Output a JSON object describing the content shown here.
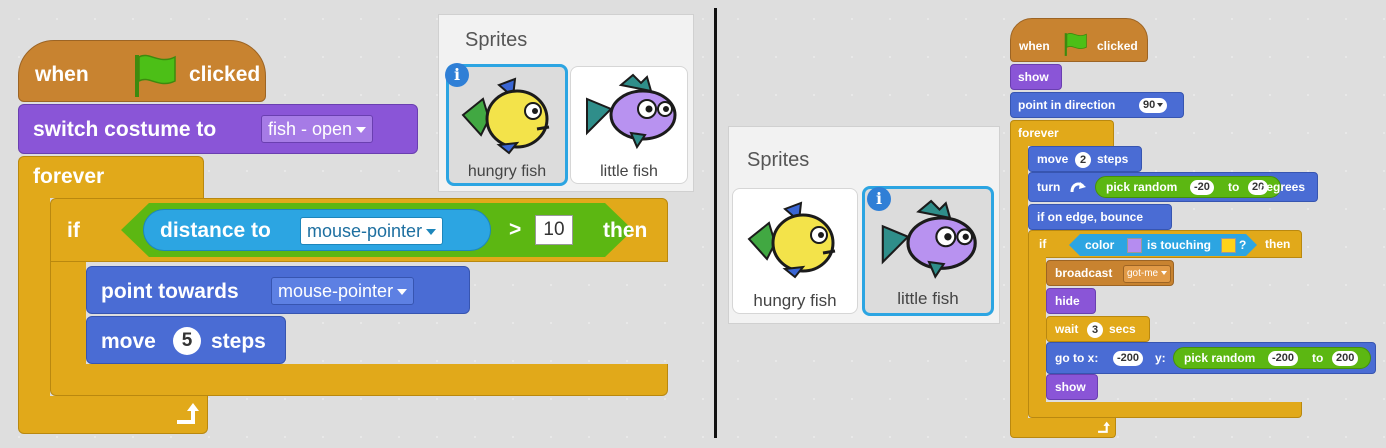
{
  "left": {
    "hat": {
      "when": "when",
      "clicked": "clicked",
      "icon": "green-flag-icon"
    },
    "switch_costume": {
      "label": "switch costume to",
      "value": "fish - open"
    },
    "forever": "forever",
    "if_block": {
      "if": "if",
      "sensing_label": "distance to",
      "sensing_value": "mouse-pointer",
      "op": ">",
      "compare": "10",
      "then": "then"
    },
    "point_towards": {
      "label": "point towards",
      "value": "mouse-pointer"
    },
    "move": {
      "label": "move",
      "value": "5",
      "suffix": "steps"
    },
    "sprites": {
      "title": "Sprites",
      "items": [
        {
          "name": "hungry fish",
          "selected": true
        },
        {
          "name": "little fish",
          "selected": false
        }
      ]
    }
  },
  "right": {
    "sprites": {
      "title": "Sprites",
      "items": [
        {
          "name": "hungry fish",
          "selected": false
        },
        {
          "name": "little fish",
          "selected": true
        }
      ]
    },
    "hat": {
      "when": "when",
      "clicked": "clicked",
      "icon": "green-flag-icon"
    },
    "show1": "show",
    "point_direction": {
      "label": "point in direction",
      "value": "90"
    },
    "forever": "forever",
    "move": {
      "label": "move",
      "value": "2",
      "suffix": "steps"
    },
    "turn": {
      "label": "turn",
      "pick": "pick random",
      "from": "-20",
      "to_word": "to",
      "to": "20",
      "suffix": "degrees"
    },
    "bounce": "if on edge, bounce",
    "if_block": {
      "if": "if",
      "color": "color",
      "touching": "is touching",
      "q": "?",
      "then": "then"
    },
    "broadcast": {
      "label": "broadcast",
      "value": "got-me"
    },
    "hide": "hide",
    "wait": {
      "label": "wait",
      "value": "3",
      "suffix": "secs"
    },
    "goto": {
      "label": "go to x:",
      "x": "-200",
      "y_label": "y:",
      "pick": "pick random",
      "from": "-200",
      "to_word": "to",
      "to": "200"
    },
    "show2": "show"
  },
  "colors": {
    "events": "#c88330",
    "looks": "#8a55d7",
    "control": "#e1a91a",
    "motion": "#4a6cd4",
    "operators": "#5cb712",
    "sensing": "#2ca5e2",
    "selected_border": "#2ca5e2",
    "touch_color_1": "#b58cf0",
    "touch_color_2": "#ffd21a"
  }
}
